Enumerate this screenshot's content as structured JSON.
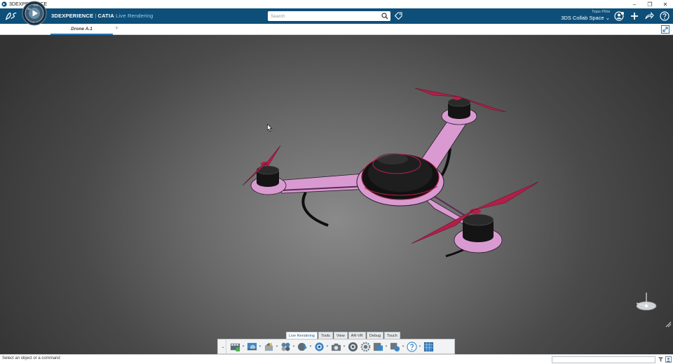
{
  "window": {
    "title": "3DEXPERIENCE",
    "min": "–",
    "restore": "❐",
    "close": "✕"
  },
  "topbar": {
    "brand_main": "3DEXPERIENCE",
    "brand_sep": "|",
    "brand_product": "CATIA",
    "brand_app": "Live Rendering",
    "search_placeholder": "Search",
    "user_name": "Tejas Pillai",
    "collab_space": "3DS Collab Space",
    "accent": "#0d4f79"
  },
  "tabs": {
    "active": "Drone A.1",
    "add": "+"
  },
  "actionbar": {
    "tabs": [
      "Live Rendering",
      "Tools",
      "View",
      "AR-VR",
      "Debug",
      "Touch"
    ],
    "active_tab": "Live Rendering",
    "collapse": "⌄",
    "tools": [
      "stage-icon",
      "environment-icon",
      "scene-icon",
      "materials-icon",
      "decals-icon",
      "camera-view-icon",
      "snapshot-icon",
      "render-icon",
      "settings-icon",
      "export-icon",
      "options-icon",
      "help-icon",
      "texture-icon"
    ]
  },
  "statusbar": {
    "message": "Select an object or a command",
    "command_input": ""
  },
  "model": {
    "body_color": "#d89ad0",
    "propeller_color": "#b1204a",
    "motor_color": "#151515"
  }
}
